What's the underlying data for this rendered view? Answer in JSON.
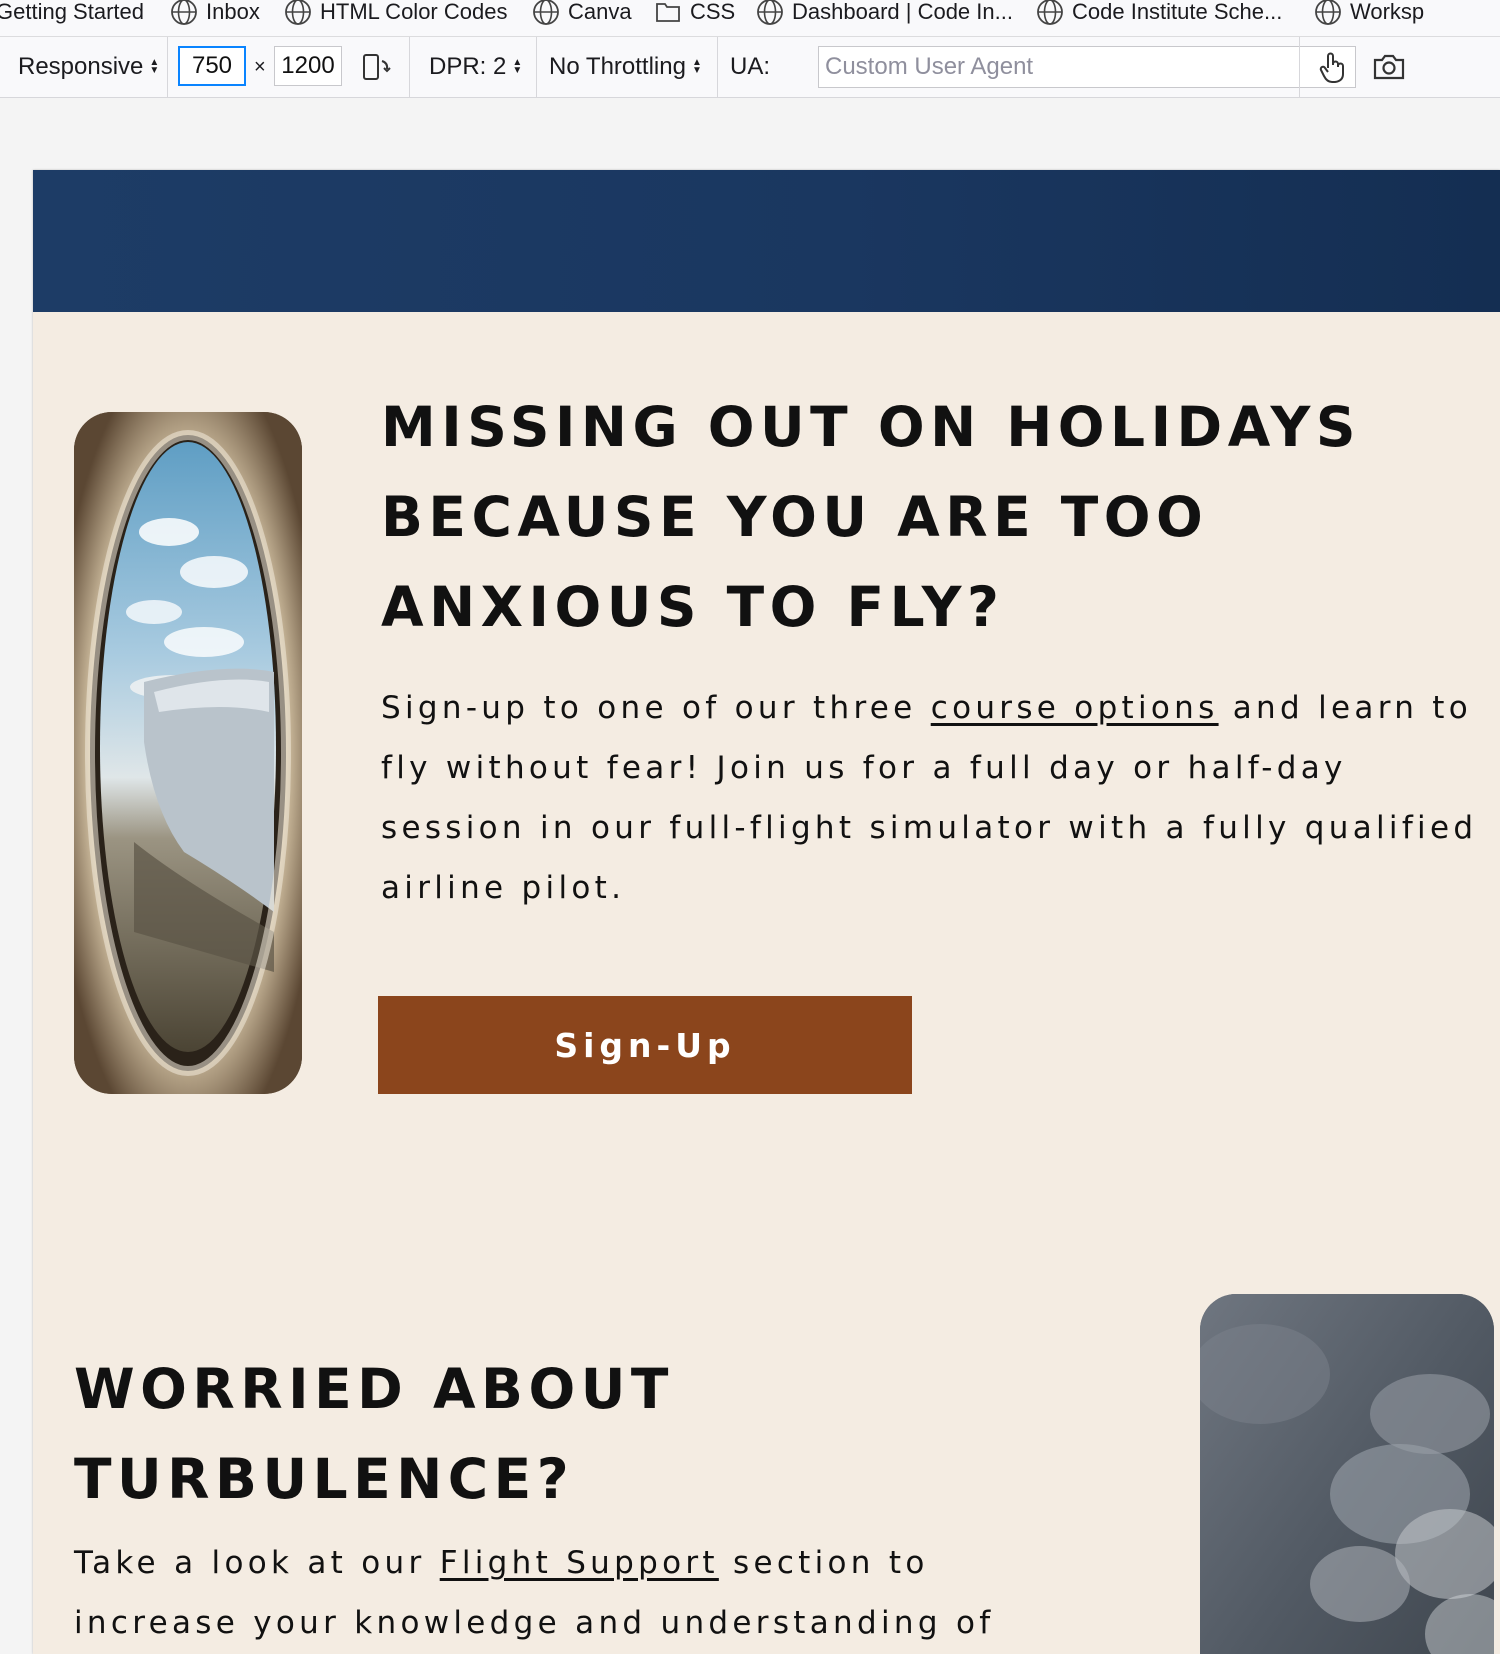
{
  "bookmarks": [
    {
      "label": "Getting Started",
      "icon": "none"
    },
    {
      "label": "Inbox",
      "icon": "globe-icon"
    },
    {
      "label": "HTML Color Codes",
      "icon": "globe-icon"
    },
    {
      "label": "Canva",
      "icon": "globe-icon"
    },
    {
      "label": "CSS",
      "icon": "folder-icon"
    },
    {
      "label": "Dashboard | Code In...",
      "icon": "globe-icon"
    },
    {
      "label": "Code Institute Sche...",
      "icon": "globe-icon"
    },
    {
      "label": "Worksp",
      "icon": "globe-icon"
    }
  ],
  "toolbar": {
    "device": "Responsive",
    "width": "750",
    "times": "×",
    "height": "1200",
    "dpr": "DPR: 2",
    "throttling": "No Throttling",
    "ua_label": "UA:",
    "ua_placeholder": "Custom User Agent"
  },
  "colors": {
    "hero_band": "#1d3c66",
    "page_bg": "#f4ece2",
    "button_bg": "#8b451c",
    "focus": "#0a84ff"
  },
  "section1": {
    "heading": "MISSING OUT ON HOLIDAYS BECAUSE YOU ARE TOO ANXIOUS TO FLY?",
    "para_before": "Sign-up to one of our three ",
    "link": "course options",
    "para_after": " and learn to fly without fear! Join us for a full day or half-day session in our full-flight simulator with a fully qualified airline pilot.",
    "button": "Sign-Up"
  },
  "section2": {
    "heading": "WORRIED ABOUT TURBULENCE?",
    "para_before": "Take a look at our ",
    "link": "Flight Support",
    "para_after": " section to increase your knowledge and understanding of"
  }
}
